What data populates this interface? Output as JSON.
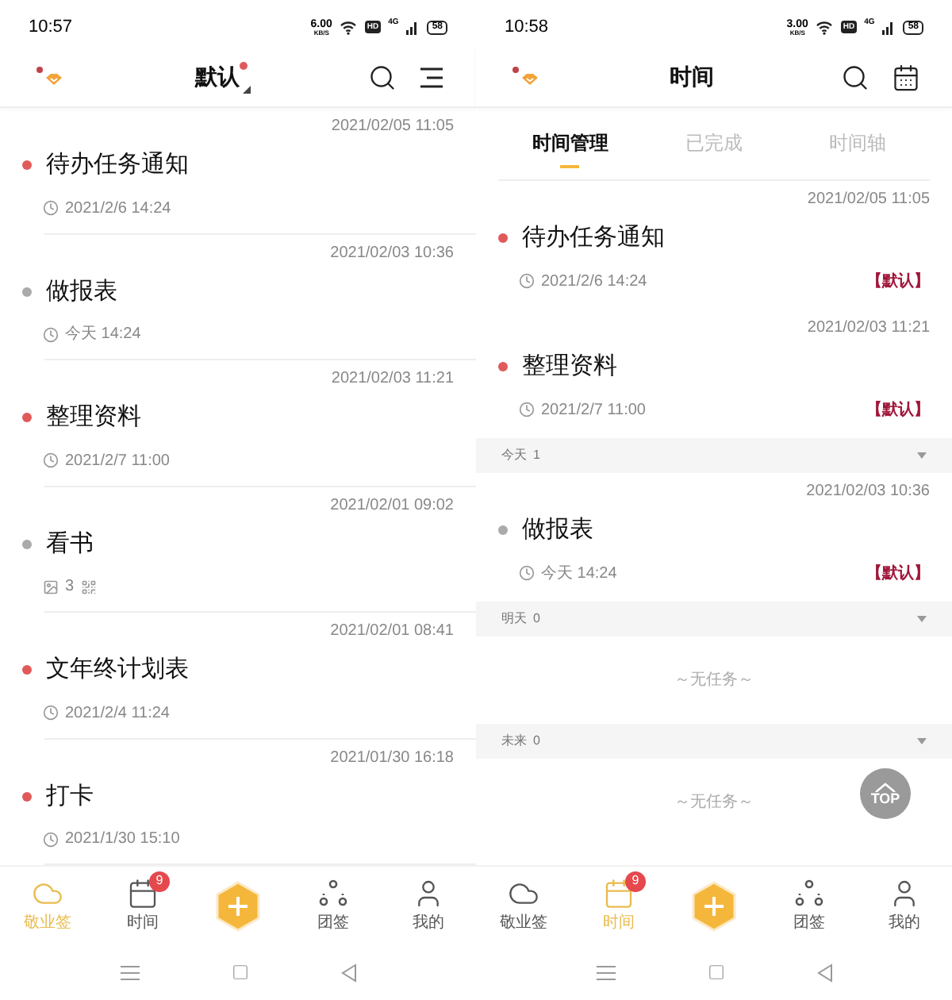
{
  "screens": [
    {
      "status_bar": {
        "time": "10:57",
        "speed": "6.00",
        "speed_unit": "KB/S",
        "hd": "HD",
        "network": "4G",
        "battery": "58"
      },
      "header": {
        "title": "默认",
        "title_dot": true,
        "dropdown": true,
        "actions": [
          {
            "kind": "search"
          },
          {
            "kind": "menu"
          }
        ]
      },
      "tasks": [
        {
          "date": "2021/02/05 11:05",
          "title": "待办任务通知",
          "color": "#e05a5a",
          "meta": {
            "kind": "due",
            "text": "2021/2/6 14:24"
          }
        },
        {
          "date": "2021/02/03 10:36",
          "title": "做报表",
          "color": "#aaaaaa",
          "meta": {
            "kind": "due",
            "text": "今天 14:24"
          }
        },
        {
          "date": "2021/02/03 11:21",
          "title": "整理资料",
          "color": "#e05a5a",
          "meta": {
            "kind": "due",
            "text": "2021/2/7 11:00"
          }
        },
        {
          "date": "2021/02/01 09:02",
          "title": "看书",
          "color": "#aaaaaa",
          "meta": {
            "kind": "attachments",
            "text": "3"
          }
        },
        {
          "date": "2021/02/01 08:41",
          "title": "文年终计划表",
          "color": "#e05a5a",
          "meta": {
            "kind": "due",
            "text": "2021/2/4 11:24"
          }
        },
        {
          "date": "2021/01/30 16:18",
          "title": "打卡",
          "color": "#e05a5a",
          "meta": {
            "kind": "due",
            "text": "2021/1/30 15:10"
          }
        }
      ],
      "nav": [
        {
          "kind": "cloud",
          "label": "敬业签",
          "selected": true
        },
        {
          "kind": "calendar",
          "label": "时间",
          "badge": "9",
          "selected": false
        },
        {
          "kind": "add"
        },
        {
          "kind": "team",
          "label": "团签",
          "selected": false
        },
        {
          "kind": "person",
          "label": "我的",
          "selected": false
        }
      ]
    },
    {
      "status_bar": {
        "time": "10:58",
        "speed": "3.00",
        "speed_unit": "KB/S",
        "hd": "HD",
        "network": "4G",
        "battery": "58"
      },
      "header": {
        "title": "时间",
        "actions": [
          {
            "kind": "search"
          },
          {
            "kind": "calendar"
          }
        ]
      },
      "tabs": [
        {
          "label": "时间管理",
          "selected": true
        },
        {
          "label": "已完成",
          "selected": false
        },
        {
          "label": "时间轴",
          "selected": false
        }
      ],
      "tasks": [
        {
          "date": "2021/02/05 11:05",
          "title": "待办任务通知",
          "color": "#e05a5a",
          "tag": "【默认】",
          "meta": {
            "kind": "due",
            "text": "2021/2/6 14:24"
          }
        },
        {
          "date": "2021/02/03 11:21",
          "title": "整理资料",
          "color": "#e05a5a",
          "tag": "【默认】",
          "meta": {
            "kind": "due",
            "text": "2021/2/7 11:00"
          }
        }
      ],
      "sections": [
        {
          "label": "今天",
          "count": "1",
          "tasks": [
            {
              "date": "2021/02/03 10:36",
              "title": "做报表",
              "color": "#aaaaaa",
              "tag": "【默认】",
              "meta": {
                "kind": "due",
                "text": "今天 14:24"
              }
            }
          ]
        },
        {
          "label": "明天",
          "count": "0",
          "empty": "～无任务～"
        },
        {
          "label": "未来",
          "count": "0",
          "empty": "～无任务～"
        }
      ],
      "top_button": "TOP",
      "nav": [
        {
          "kind": "cloud",
          "label": "敬业签",
          "selected": false
        },
        {
          "kind": "calendar",
          "label": "时间",
          "badge": "9",
          "selected": true
        },
        {
          "kind": "add"
        },
        {
          "kind": "team",
          "label": "团签",
          "selected": false
        },
        {
          "kind": "person",
          "label": "我的",
          "selected": false
        }
      ]
    }
  ]
}
